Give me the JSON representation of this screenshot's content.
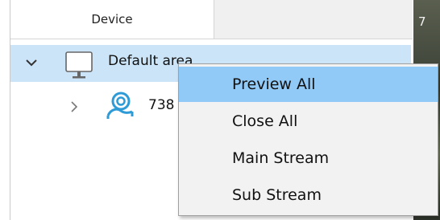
{
  "tree": {
    "header": "Device",
    "area_label": "Default area",
    "camera_label": "738"
  },
  "right_strip": {
    "text": "7"
  },
  "context_menu": {
    "items": [
      {
        "label": "Preview All",
        "highlighted": true
      },
      {
        "label": "Close All"
      },
      {
        "label": "Main Stream"
      },
      {
        "label": "Sub Stream"
      }
    ]
  },
  "icons": {
    "expand_down": "chevron-down-icon",
    "expand_right": "chevron-right-icon",
    "monitor": "monitor-icon",
    "camera": "camera-icon"
  },
  "colors": {
    "selection": "#cce4f7",
    "menu_highlight": "#91c9f7",
    "camera_icon": "#2e9bd6"
  }
}
